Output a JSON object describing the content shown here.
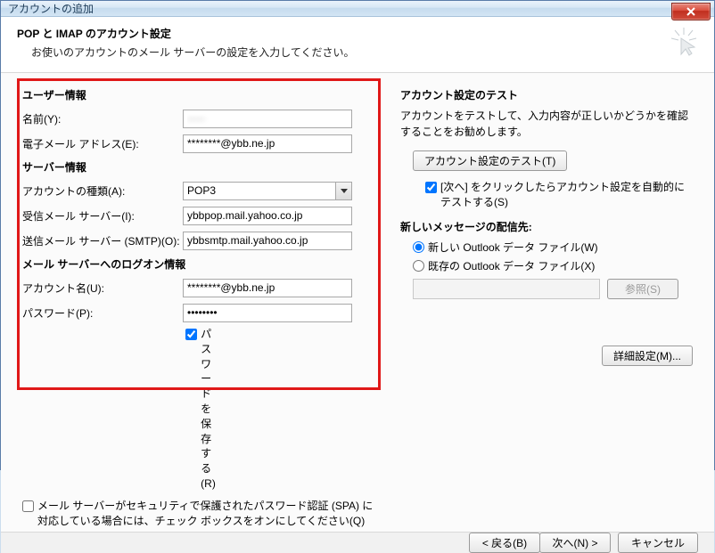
{
  "titlebar": {
    "title": "アカウントの追加"
  },
  "header": {
    "title": "POP と IMAP のアカウント設定",
    "subtitle": "お使いのアカウントのメール サーバーの設定を入力してください。"
  },
  "left": {
    "userinfo_heading": "ユーザー情報",
    "name_label": "名前(Y):",
    "name_value": "-----",
    "email_label": "電子メール アドレス(E):",
    "email_value": "********@ybb.ne.jp",
    "serverinfo_heading": "サーバー情報",
    "acct_type_label": "アカウントの種類(A):",
    "acct_type_value": "POP3",
    "incoming_label": "受信メール サーバー(I):",
    "incoming_value": "ybbpop.mail.yahoo.co.jp",
    "outgoing_label": "送信メール サーバー (SMTP)(O):",
    "outgoing_value": "ybbsmtp.mail.yahoo.co.jp",
    "logon_heading": "メール サーバーへのログオン情報",
    "account_label": "アカウント名(U):",
    "account_value": "********@ybb.ne.jp",
    "password_label": "パスワード(P):",
    "password_value": "********",
    "save_password_label": "パスワードを保存する(R)",
    "spa_label": "メール サーバーがセキュリティで保護されたパスワード認証 (SPA) に対応している場合には、チェック ボックスをオンにしてください(Q)"
  },
  "right": {
    "test_heading": "アカウント設定のテスト",
    "test_desc": "アカウントをテストして、入力内容が正しいかどうかを確認することをお勧めします。",
    "test_button": "アカウント設定のテスト(T)",
    "auto_test_label": "[次へ] をクリックしたらアカウント設定を自動的にテストする(S)",
    "delivery_heading": "新しいメッセージの配信先:",
    "radio_new_label": "新しい Outlook データ ファイル(W)",
    "radio_existing_label": "既存の Outlook データ ファイル(X)",
    "browse_button": "参照(S)",
    "advanced_button": "詳細設定(M)..."
  },
  "footer": {
    "back": "< 戻る(B)",
    "next": "次へ(N) >",
    "cancel": "キャンセル"
  }
}
